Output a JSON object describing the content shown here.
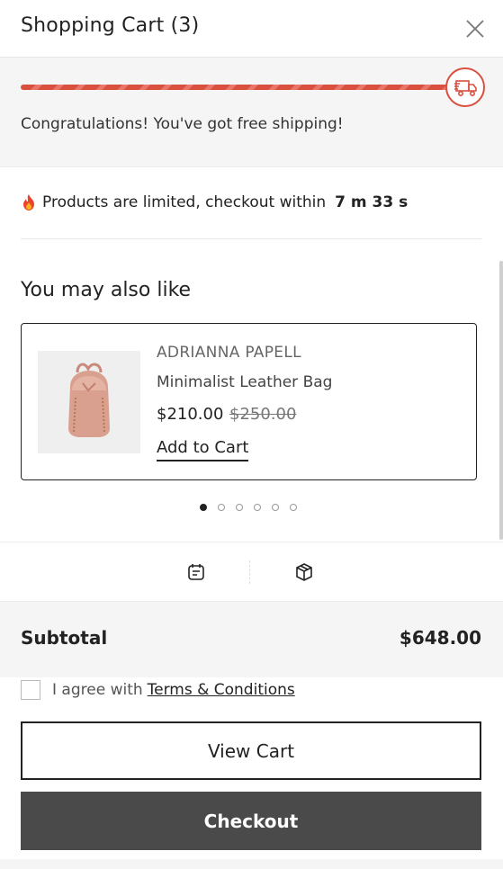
{
  "header": {
    "title": "Shopping Cart (3)",
    "close_icon": "close-icon"
  },
  "shipping": {
    "progress_percent": 100,
    "message": "Congratulations! You've got free shipping!",
    "icon": "truck-icon",
    "accent_color": "#d9503f"
  },
  "urgency": {
    "icon": "fire-icon",
    "message": "Products are limited, checkout within",
    "timer": "7 m 33 s"
  },
  "recommendations": {
    "title": "You may also like",
    "products": [
      {
        "brand": "ADRIANNA PAPELL",
        "name": "Minimalist Leather Bag",
        "price": "$210.00",
        "old_price": "$250.00",
        "add_label": "Add to Cart",
        "image": "backpack-image"
      }
    ],
    "slide_count": 6,
    "active_slide": 1
  },
  "tools": [
    {
      "icon": "note-icon"
    },
    {
      "icon": "package-icon"
    }
  ],
  "totals": {
    "subtotal_label": "Subtotal",
    "subtotal_value": "$648.00"
  },
  "terms": {
    "prefix": "I agree with",
    "link": "Terms & Conditions",
    "checked": false
  },
  "actions": {
    "view_cart": "View Cart",
    "checkout": "Checkout",
    "checkout_color": "#4a4a4a"
  }
}
